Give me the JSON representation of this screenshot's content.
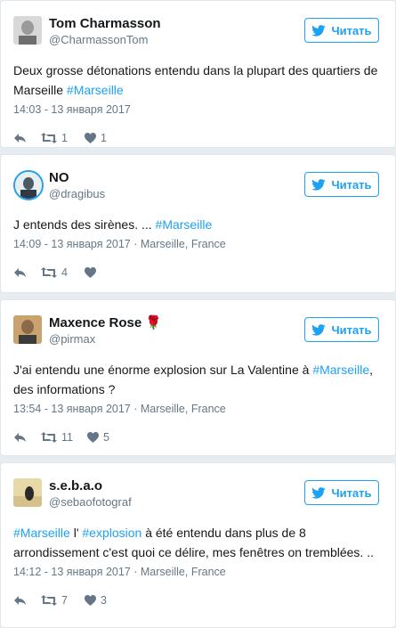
{
  "follow_label": "Читать",
  "tweets": [
    {
      "name": "Tom Charmasson",
      "handle": "@CharmassonTom",
      "text_before": "Deux grosse détonations entendu dans la plupart des quartiers de Marseille ",
      "hashtag1": "#Marseille",
      "time": "14:03 - 13 января 2017",
      "location": "",
      "retweets": "1",
      "likes": "1"
    },
    {
      "name": "NO",
      "handle": "@dragibus",
      "text_before": "J entends des sirènes. ... ",
      "hashtag1": "#Marseille",
      "time": "14:09 - 13 января 2017",
      "location": " · Marseille, France",
      "retweets": "4",
      "likes": ""
    },
    {
      "name": "Maxence Rose",
      "name_emoji": "🌹",
      "handle": "@pirmax",
      "text_before": "J'ai entendu une énorme explosion sur La Valentine à ",
      "hashtag1": "#Marseille",
      "text_after": ", des informations ?",
      "time": "13:54 - 13 января 2017",
      "location": " · Marseille, France",
      "retweets": "11",
      "likes": "5"
    },
    {
      "name": "s.e.b.a.o",
      "handle": "@sebaofotograf",
      "hashtag1": "#Marseille",
      "text_mid": " l' ",
      "hashtag2": "#explosion",
      "text_after": " à été entendu dans plus de 8 arrondissement c'est quoi ce délire, mes fenêtres on tremblées. ..",
      "time": "14:12 - 13 января 2017",
      "location": " · Marseille, France",
      "retweets": "7",
      "likes": "3"
    }
  ],
  "icons": {
    "bird": "twitter-bird-icon",
    "reply": "reply-icon",
    "retweet": "retweet-icon",
    "like": "heart-icon"
  }
}
